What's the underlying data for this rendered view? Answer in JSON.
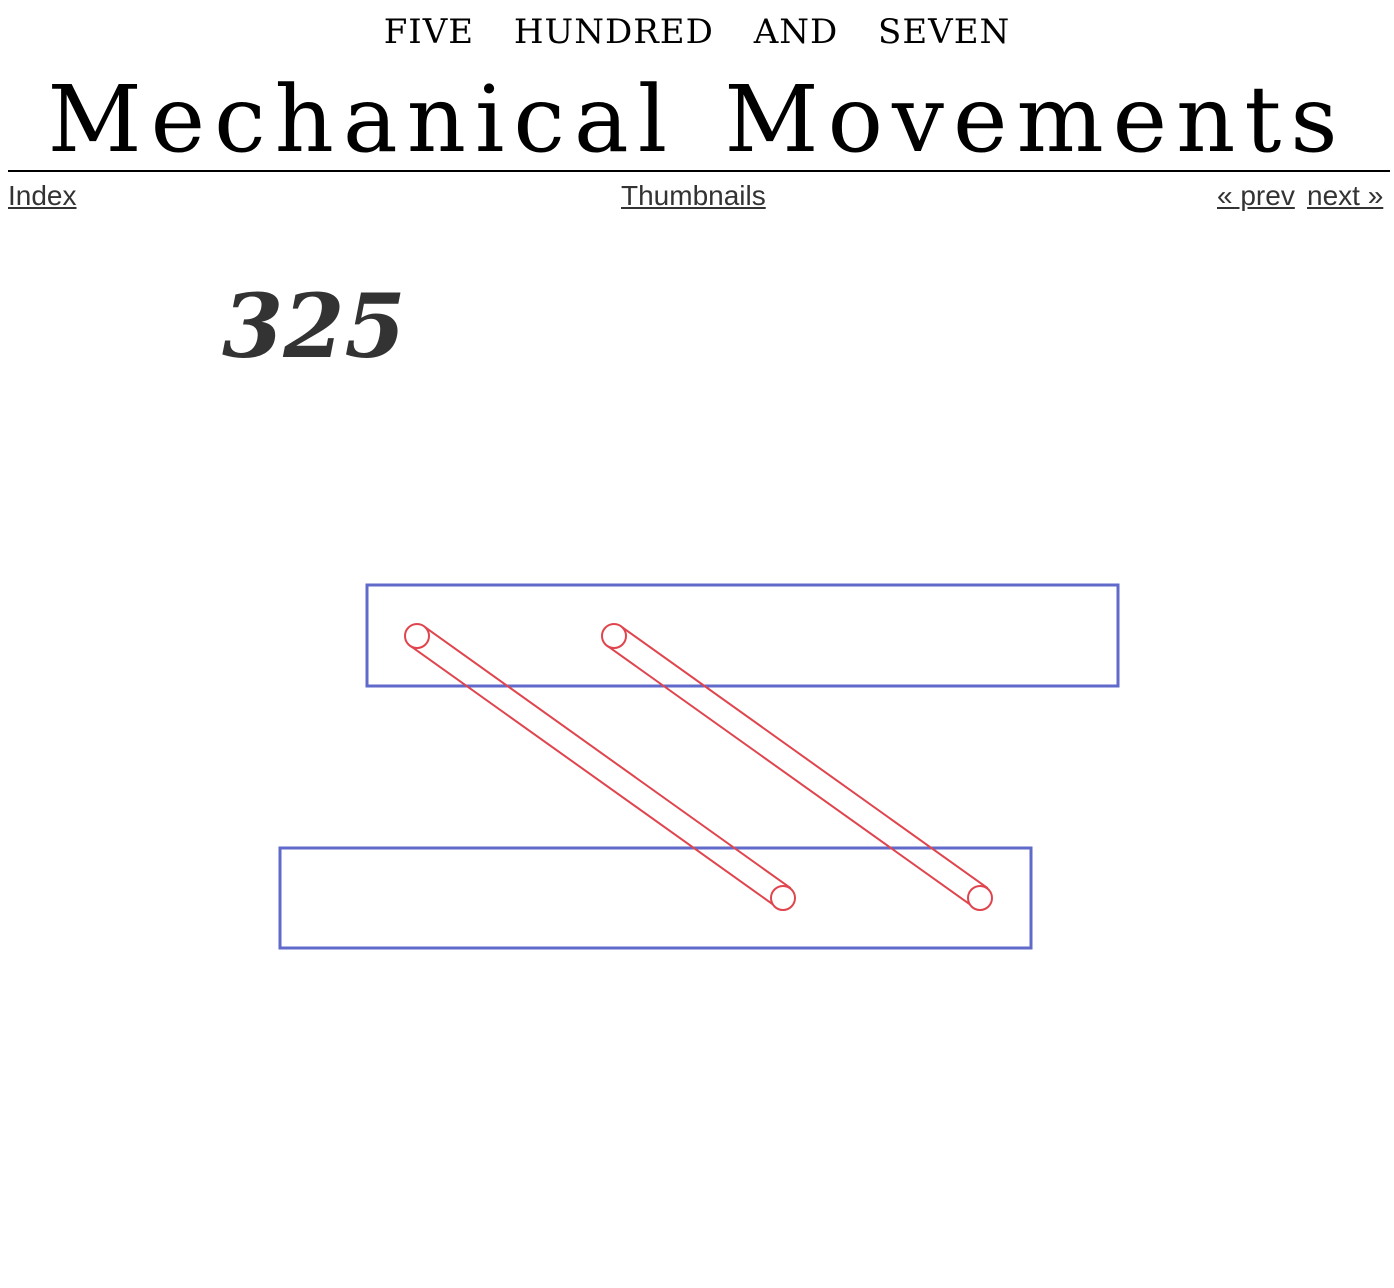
{
  "header": {
    "supertitle": "FIVE HUNDRED AND SEVEN",
    "title": "Mechanical Movements"
  },
  "nav": {
    "index_label": "Index",
    "thumbnails_label": "Thumbnails",
    "prev_label": "« prev",
    "next_label": "next »"
  },
  "figure": {
    "number": "325",
    "colors": {
      "bars": "#5f6acb",
      "links": "#e0454e",
      "number": "#333333"
    }
  }
}
